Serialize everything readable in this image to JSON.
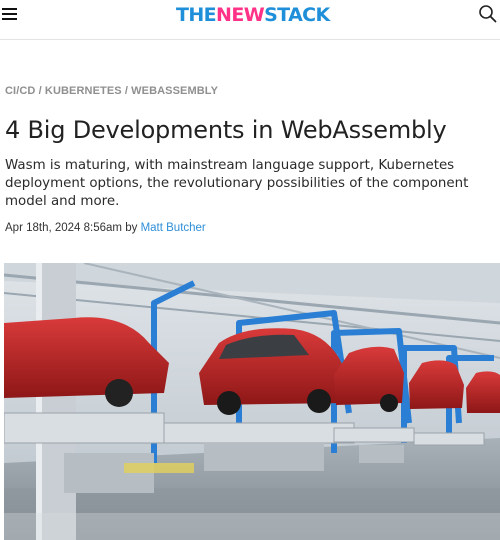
{
  "header": {
    "logo": {
      "part1": "THE",
      "part2": "NEW",
      "part3": "STACK"
    },
    "menu_icon": "hamburger-menu-icon",
    "search_icon": "search-icon"
  },
  "article": {
    "categories": [
      "CI/CD",
      "KUBERNETES",
      "WEBASSEMBLY"
    ],
    "categories_text": "CI/CD / KUBERNETES / WEBASSEMBLY",
    "title": "4 Big Developments in WebAssembly",
    "subtitle": "Wasm is maturing, with mainstream language support, Kubernetes deployment options, the revolutionary possibilities of the component model and more.",
    "date": "Apr 18th, 2024 8:56am",
    "by": "by",
    "author": "Matt Butcher"
  },
  "colors": {
    "logo_blue": "#1e8fd8",
    "logo_pink": "#ff3287",
    "link_blue": "#2f8fd8",
    "category_gray": "#8f8f8f"
  }
}
